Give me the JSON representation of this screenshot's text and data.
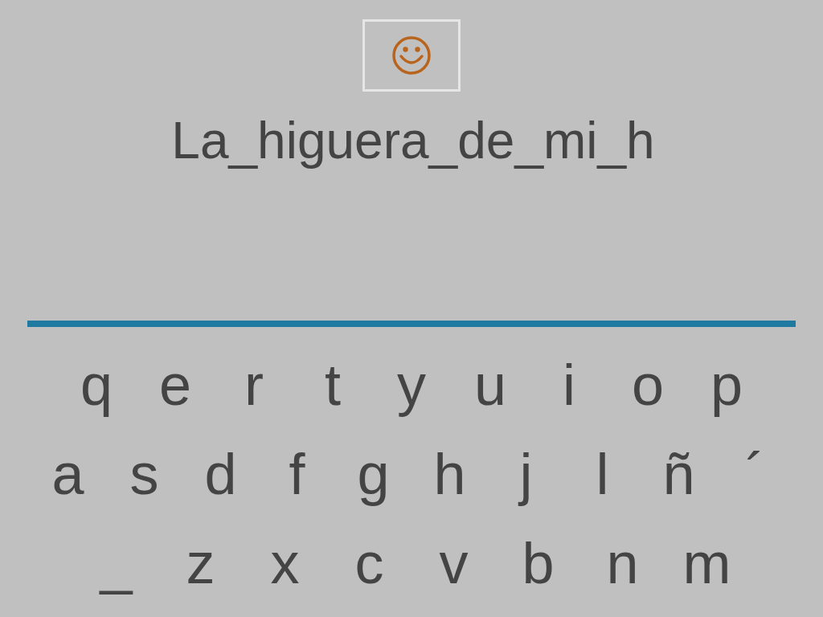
{
  "phrase": "La_higuera_de_mi_h",
  "keyboard": {
    "rows": [
      [
        "q",
        "e",
        "r",
        "t",
        "y",
        "u",
        "i",
        "o",
        "p"
      ],
      [
        "a",
        "s",
        "d",
        "f",
        "g",
        "h",
        "j",
        "l",
        "ñ",
        "´"
      ],
      [
        "_",
        "z",
        "x",
        "c",
        "v",
        "b",
        "n",
        "m"
      ]
    ]
  }
}
